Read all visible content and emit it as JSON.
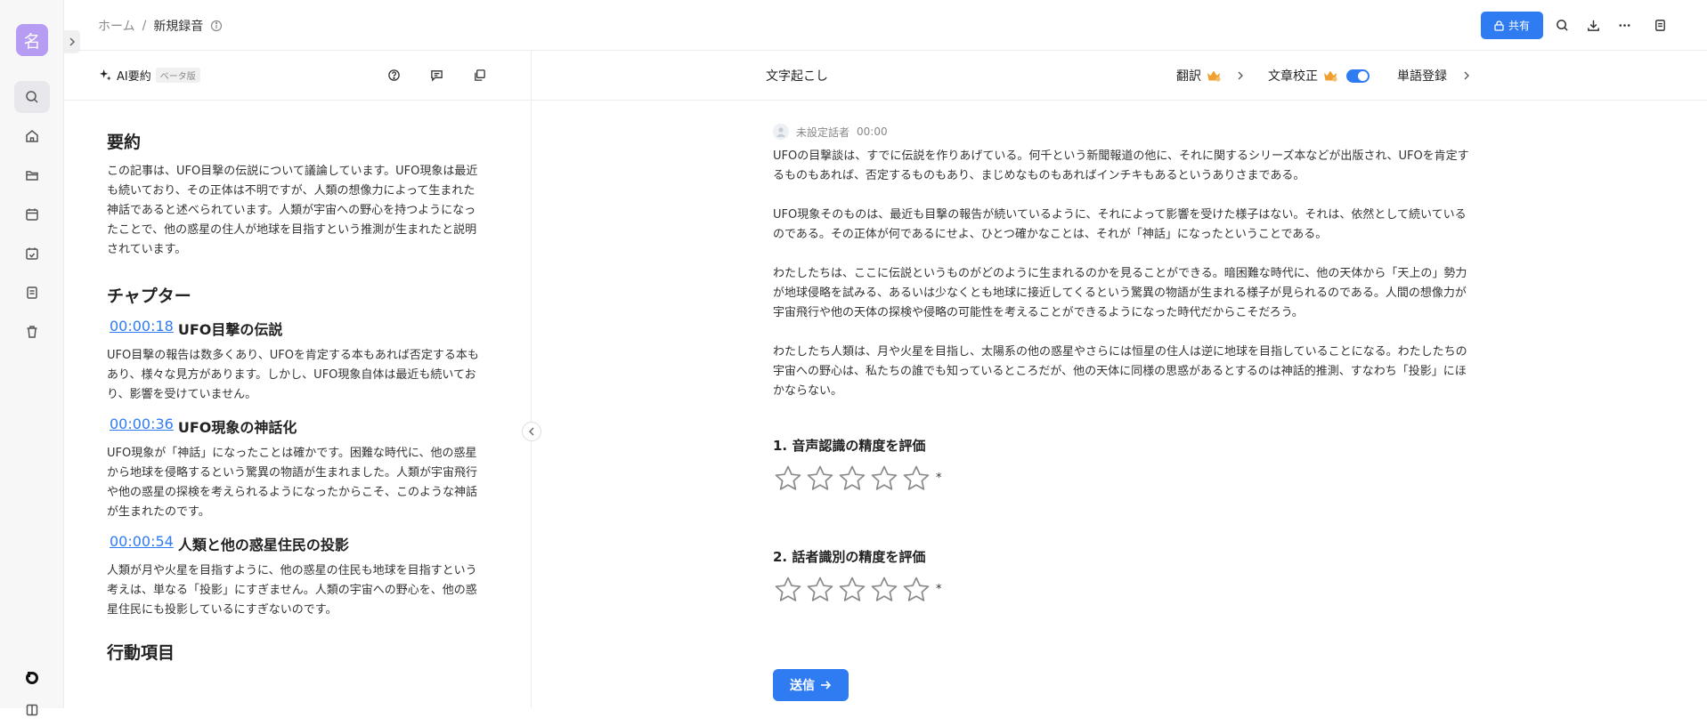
{
  "rail": {
    "avatar_letter": "名",
    "items": [
      {
        "icon": "search-icon"
      },
      {
        "icon": "home-icon"
      },
      {
        "icon": "folder-icon"
      },
      {
        "icon": "calendar-icon"
      },
      {
        "icon": "calendar-check-icon"
      },
      {
        "icon": "document-list-icon"
      },
      {
        "icon": "trash-icon"
      }
    ]
  },
  "topbar": {
    "breadcrumb_home": "ホーム",
    "breadcrumb_sep": "/",
    "breadcrumb_current": "新規録音",
    "share_label": "共有"
  },
  "left_panel": {
    "ai_summary_label": "AI要約",
    "beta_badge": "ベータ版",
    "summary_heading": "要約",
    "summary_text": "この記事は、UFO目撃の伝説について議論しています。UFO現象は最近も続いており、その正体は不明ですが、人類の想像力によって生まれた神話であると述べられています。人類が宇宙への野心を持つようになったことで、他の惑星の住人が地球を目指すという推測が生まれたと説明されています。",
    "chapters_heading": "チャプター",
    "chapters": [
      {
        "timestamp": "00:00:18",
        "title": "UFO目撃の伝説",
        "text": "UFO目撃の報告は数多くあり、UFOを肯定する本もあれば否定する本もあり、様々な見方があります。しかし、UFO現象自体は最近も続いており、影響を受けていません。"
      },
      {
        "timestamp": "00:00:36",
        "title": "UFO現象の神話化",
        "text": "UFO現象が「神話」になったことは確かです。困難な時代に、他の惑星から地球を侵略するという驚異の物語が生まれました。人類が宇宙飛行や他の惑星の探検を考えられるようになったからこそ、このような神話が生まれたのです。"
      },
      {
        "timestamp": "00:00:54",
        "title": "人類と他の惑星住民の投影",
        "text": "人類が月や火星を目指すように、他の惑星の住民も地球を目指すという考えは、単なる「投影」にすぎません。人類の宇宙への野心を、他の惑星住民にも投影しているにすぎないのです。"
      }
    ],
    "action_items_heading": "行動項目"
  },
  "right_panel": {
    "tab_transcript": "文字起こし",
    "translate_label": "翻訳",
    "proofread_label": "文章校正",
    "proofread_enabled": true,
    "word_register_label": "単語登録",
    "speaker_name": "未設定話者",
    "speaker_time": "00:00",
    "transcript_paragraphs": [
      "UFOの目撃談は、すでに伝説を作りあげている。何千という新聞報道の他に、それに関するシリーズ本などが出版され、UFOを肯定するものもあれば、否定するものもあり、まじめなものもあればインチキもあるというありさまである。",
      "UFO現象そのものは、最近も目撃の報告が続いているように、それによって影響を受けた様子はない。それは、依然として続いているのである。その正体が何であるにせよ、ひとつ確かなことは、それが「神話」になったということである。",
      "わたしたちは、ここに伝説というものがどのように生まれるのかを見ることができる。暗困難な時代に、他の天体から「天上の」勢力が地球侵略を試みる、あるいは少なくとも地球に接近してくるという驚異の物語が生まれる様子が見られるのである。人間の想像力が宇宙飛行や他の天体の探検や侵略の可能性を考えることができるようになった時代だからこそだろう。",
      "わたしたち人類は、月や火星を目指し、太陽系の他の惑星やさらには恒星の住人は逆に地球を目指していることになる。わたしたちの宇宙への野心は、私たちの誰でも知っているところだが、他の天体に同様の思惑があるとするのは神話的推測、すなわち「投影」にほかならない。"
    ],
    "ratings": [
      {
        "question": "1. 音声認識の精度を評価",
        "stars": 5,
        "rating": 0,
        "required_mark": "*"
      },
      {
        "question": "2. 話者識別の精度を評価",
        "stars": 5,
        "rating": 0,
        "required_mark": "*"
      }
    ],
    "submit_label": "送信"
  }
}
